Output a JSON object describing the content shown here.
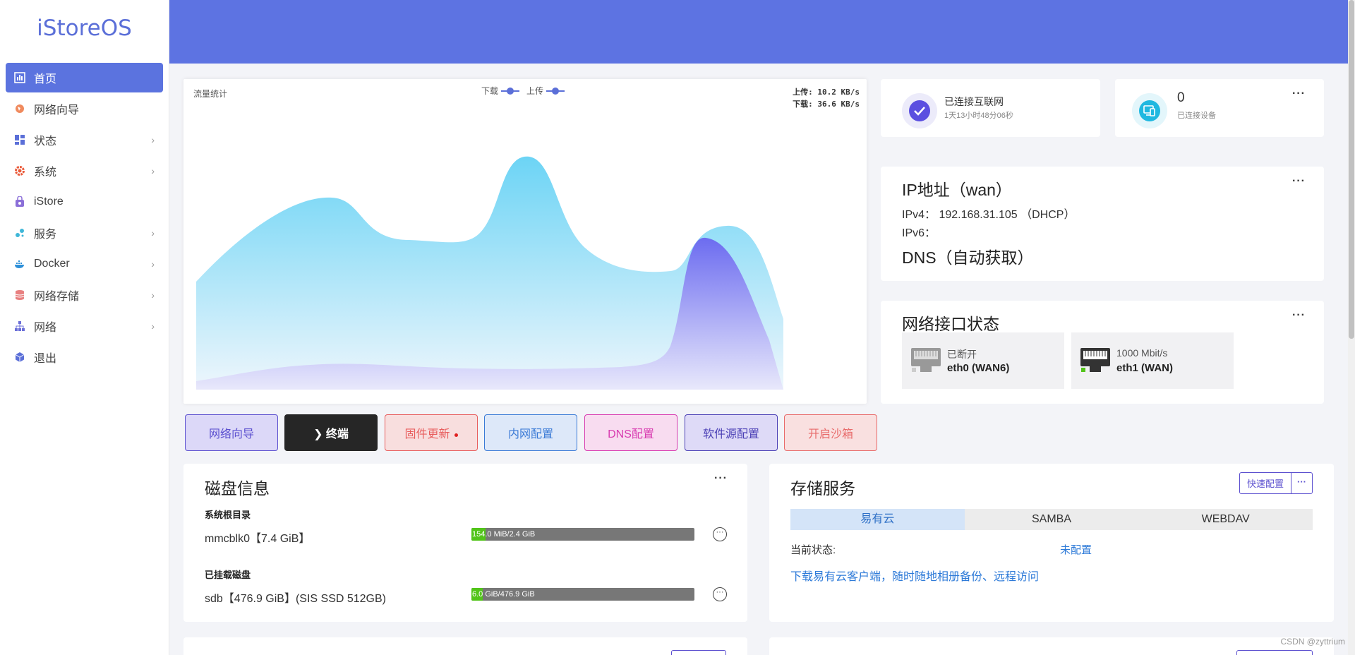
{
  "brand": "iStoreOS",
  "sidebar": {
    "items": [
      {
        "label": "首页",
        "icon": "dashboard-icon",
        "has_sub": false,
        "active": true
      },
      {
        "label": "网络向导",
        "icon": "globe-icon",
        "has_sub": false
      },
      {
        "label": "状态",
        "icon": "grid-icon",
        "has_sub": true
      },
      {
        "label": "系统",
        "icon": "gear-icon",
        "has_sub": true
      },
      {
        "label": "iStore",
        "icon": "store-icon",
        "has_sub": false
      },
      {
        "label": "服务",
        "icon": "services-icon",
        "has_sub": true
      },
      {
        "label": "Docker",
        "icon": "docker-icon",
        "has_sub": true
      },
      {
        "label": "网络存储",
        "icon": "storage-icon",
        "has_sub": true
      },
      {
        "label": "网络",
        "icon": "network-icon",
        "has_sub": true
      },
      {
        "label": "退出",
        "icon": "logout-icon",
        "has_sub": false
      }
    ],
    "chevron": "›"
  },
  "traffic": {
    "title": "流量统计",
    "legend_down": "下载",
    "legend_up": "上传",
    "upload_rate": "上传: 10.2 KB/s",
    "download_rate": "下载: 36.6 KB/s"
  },
  "connection": {
    "status": "已连接互联网",
    "uptime": "1天13小时48分06秒"
  },
  "devices": {
    "count": "0",
    "label": "已连接设备",
    "more": "···"
  },
  "ip": {
    "title": "IP地址（wan）",
    "ipv4": "IPv4： 192.168.31.105 （DHCP）",
    "ipv6": "IPv6：",
    "dns": "DNS（自动获取）",
    "more": "···"
  },
  "net_status": {
    "title": "网络接口状态",
    "more": "···",
    "ports": [
      {
        "status": "已断开",
        "name": "eth0 (WAN6)"
      },
      {
        "status": "1000 Mbit/s",
        "name": "eth1 (WAN)"
      }
    ]
  },
  "quick_buttons": [
    {
      "label": "网络向导",
      "color": "#5b4fcf"
    },
    {
      "label": "❯ 终端",
      "color": "#ffffff"
    },
    {
      "label": "固件更新",
      "color": "#e85c5c"
    },
    {
      "label": "内网配置",
      "color": "#3a7ad6"
    },
    {
      "label": "DNS配置",
      "color": "#d83bb0"
    },
    {
      "label": "软件源配置",
      "color": "#4a3fb5"
    },
    {
      "label": "开启沙箱",
      "color": "#e86a6a"
    }
  ],
  "disk": {
    "title": "磁盘信息",
    "more": "···",
    "root_label": "系统根目录",
    "root_name": "mmcblk0【7.4 GiB】",
    "root_usage": "154.0 MiB/2.4 GiB",
    "root_fraction": 0.063,
    "mounted_label": "已挂载磁盘",
    "mounted_name": "sdb【476.9 GiB】(SIS SSD 512GB)",
    "mounted_usage": "6.0 GiB/476.9 GiB",
    "mounted_fraction": 0.013,
    "action": "···"
  },
  "storage": {
    "title": "存储服务",
    "quick_config": "快速配置",
    "more": "···",
    "tabs": [
      "易有云",
      "SAMBA",
      "WEBDAV"
    ],
    "status_label": "当前状态:",
    "status_value": "未配置",
    "link": "下载易有云客户端，随时随地相册备份、远程访问"
  },
  "watermark": "CSDN @zyttrium",
  "colors": {
    "accent": "#5b73df",
    "header": "#5d73e2",
    "download_area": "#6cd4f5",
    "upload_area": "#7a78f0"
  }
}
